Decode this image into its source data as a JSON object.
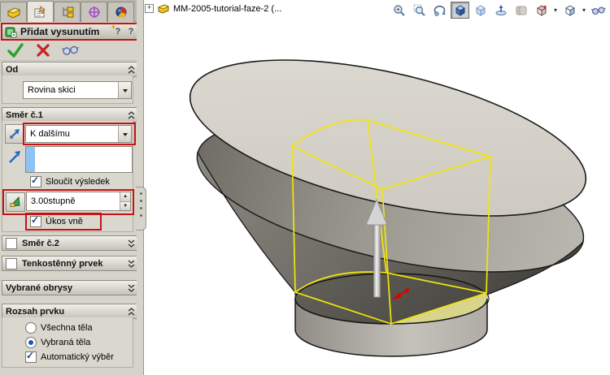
{
  "property_manager": {
    "tabs": [
      {
        "name": "feature-manager"
      },
      {
        "name": "property-manager",
        "active": true
      },
      {
        "name": "configuration-manager"
      },
      {
        "name": "dimxpert-manager"
      },
      {
        "name": "display-manager"
      }
    ],
    "title": "Přidat vysunutím",
    "help": {
      "quick_tip": "?",
      "help": "?"
    },
    "od": {
      "title": "Od",
      "value": "Rovina skici"
    },
    "smer1": {
      "title": "Směr č.1",
      "end_condition": "K dalšímu",
      "merge_result": "Sloučit výsledek",
      "merge_checked": true,
      "draft_value": "3.00stupně",
      "draft_outward": "Úkos vně",
      "draft_outward_checked": true
    },
    "smer2": {
      "title": "Směr č.2"
    },
    "thin_feature": {
      "title": "Tenkostěnný prvek"
    },
    "selected_contours": {
      "title": "Vybrané obrysy"
    },
    "feature_scope": {
      "title": "Rozsah prvku",
      "option_all": "Všechna těla",
      "option_selected": "Vybraná těla",
      "option_auto": "Automatický výběr",
      "selected_option": "Vybraná těla",
      "auto_checked": true
    }
  },
  "graphics": {
    "tree_root": "MM-2005-tutorial-faze-2  (...",
    "view_toolbar": [
      "zoom-to-fit",
      "zoom-to-area",
      "rotate-view",
      "shaded-with-edges",
      "hidden-lines-visible",
      "section-view",
      "curvature",
      "view-orientation",
      "display-style",
      "detailed-preview"
    ]
  },
  "colors": {
    "highlight_red": "#c41414",
    "preview_yellow": "#f2e50c",
    "sketch_fill": "#d9d48c",
    "top_face": "#d7d3ca",
    "selection_blue": "#8ec4f4"
  }
}
